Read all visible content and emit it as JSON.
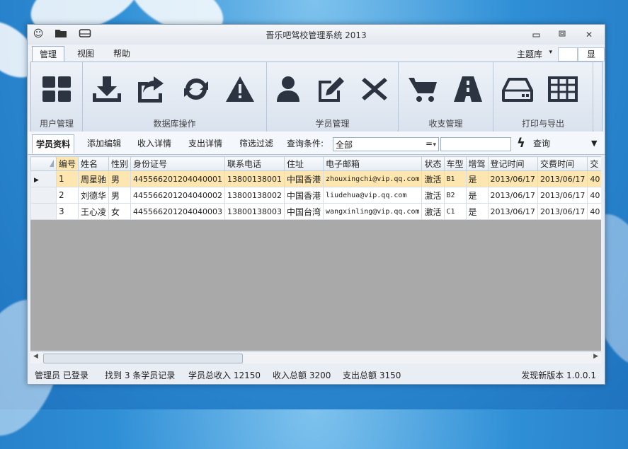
{
  "window": {
    "title": "晋乐吧驾校管理系统 2013",
    "controls": {
      "minimize": "▭",
      "restore": "◻",
      "close": "✕"
    }
  },
  "menu": {
    "tabs": [
      {
        "label": "管理",
        "active": true
      },
      {
        "label": "视图",
        "active": false
      },
      {
        "label": "帮助",
        "active": false
      }
    ],
    "theme_label": "主题库",
    "display_label": "显"
  },
  "ribbon": {
    "groups": [
      {
        "label": "用户管理",
        "buttons": [
          "grid-icon"
        ]
      },
      {
        "label": "数据库操作",
        "buttons": [
          "download-icon",
          "export-icon",
          "refresh-icon",
          "warning-icon"
        ]
      },
      {
        "label": "学员管理",
        "buttons": [
          "user-icon",
          "edit-icon",
          "delete-icon"
        ]
      },
      {
        "label": "收支管理",
        "buttons": [
          "cart-icon",
          "road-icon"
        ]
      },
      {
        "label": "打印与导出",
        "buttons": [
          "drive-icon",
          "table-icon"
        ]
      }
    ]
  },
  "subtabs": {
    "items": [
      {
        "label": "学员资料",
        "active": true
      },
      {
        "label": "添加编辑",
        "active": false
      },
      {
        "label": "收入详情",
        "active": false
      },
      {
        "label": "支出详情",
        "active": false
      },
      {
        "label": "筛选过滤",
        "active": false
      }
    ],
    "query_condition_label": "查询条件:",
    "query_condition_value": "全部",
    "equals": "=",
    "query_value": "",
    "query_button": "查询"
  },
  "table": {
    "columns": [
      "编号",
      "姓名",
      "性别",
      "身份证号",
      "联系电话",
      "住址",
      "电子邮箱",
      "状态",
      "车型",
      "增驾",
      "登记时间",
      "交费时间",
      "交"
    ],
    "rows": [
      [
        "1",
        "周星驰",
        "男",
        "445566201204040001",
        "13800138001",
        "中国香港",
        "zhouxingchi@vip.qq.com",
        "激活",
        "B1",
        "是",
        "2013/06/17",
        "2013/06/17",
        "40"
      ],
      [
        "2",
        "刘德华",
        "男",
        "445566201204040002",
        "13800138002",
        "中国香港",
        "liudehua@vip.qq.com",
        "激活",
        "B2",
        "是",
        "2013/06/17",
        "2013/06/17",
        "40"
      ],
      [
        "3",
        "王心凌",
        "女",
        "445566201204040003",
        "13800138003",
        "中国台湾",
        "wangxinling@vip.qq.com",
        "激活",
        "C1",
        "是",
        "2013/06/17",
        "2013/06/17",
        "40"
      ]
    ],
    "selected_row": 0
  },
  "status": {
    "login": "管理员 已登录",
    "found": "找到 3 条学员记录",
    "total_income": "学员总收入 12150",
    "income_total": "收入总额 3200",
    "expense_total": "支出总额 3150",
    "version": "发现新版本 1.0.0.1"
  },
  "colors": {
    "accent": "#2f8fd6",
    "selected_row": "#fde6b0",
    "icon": "#2b3440"
  }
}
